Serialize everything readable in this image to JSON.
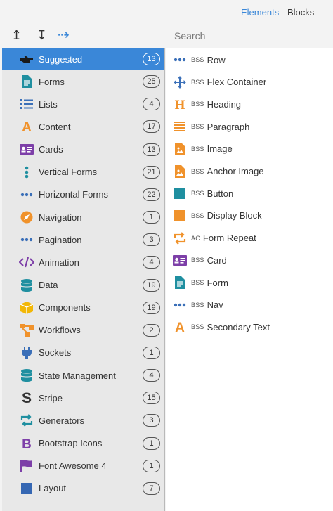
{
  "tabs": {
    "elements": "Elements",
    "blocks": "Blocks"
  },
  "toolbar": {
    "up": "↥",
    "down": "↧",
    "right": "⇢"
  },
  "search": {
    "placeholder": "Search"
  },
  "categories": [
    {
      "label": "Suggested",
      "count": "13",
      "icon": "pointing-hand-icon",
      "active": true
    },
    {
      "label": "Forms",
      "count": "25",
      "icon": "form-document-icon"
    },
    {
      "label": "Lists",
      "count": "4",
      "icon": "list-icon"
    },
    {
      "label": "Content",
      "count": "17",
      "icon": "letter-a-icon"
    },
    {
      "label": "Cards",
      "count": "13",
      "icon": "id-card-icon"
    },
    {
      "label": "Vertical Forms",
      "count": "21",
      "icon": "vertical-dots-icon"
    },
    {
      "label": "Horizontal Forms",
      "count": "22",
      "icon": "horizontal-dots-icon"
    },
    {
      "label": "Navigation",
      "count": "1",
      "icon": "compass-icon"
    },
    {
      "label": "Pagination",
      "count": "3",
      "icon": "horizontal-dots-icon"
    },
    {
      "label": "Animation",
      "count": "4",
      "icon": "code-icon"
    },
    {
      "label": "Data",
      "count": "19",
      "icon": "database-icon"
    },
    {
      "label": "Components",
      "count": "19",
      "icon": "cube-icon"
    },
    {
      "label": "Workflows",
      "count": "2",
      "icon": "workflow-icon"
    },
    {
      "label": "Sockets",
      "count": "1",
      "icon": "plug-icon"
    },
    {
      "label": "State Management",
      "count": "4",
      "icon": "database-icon"
    },
    {
      "label": "Stripe",
      "count": "15",
      "icon": "stripe-s-icon"
    },
    {
      "label": "Generators",
      "count": "3",
      "icon": "repeat-arrows-icon"
    },
    {
      "label": "Bootstrap Icons",
      "count": "1",
      "icon": "bootstrap-b-icon"
    },
    {
      "label": "Font Awesome 4",
      "count": "1",
      "icon": "flag-icon"
    },
    {
      "label": "Layout",
      "count": "7",
      "icon": "square-icon"
    }
  ],
  "elements": [
    {
      "prefix": "BSS",
      "label": "Row",
      "icon": "horizontal-dots-icon"
    },
    {
      "prefix": "BSS",
      "label": "Flex Container",
      "icon": "move-arrows-icon"
    },
    {
      "prefix": "BSS",
      "label": "Heading",
      "icon": "heading-h-icon"
    },
    {
      "prefix": "BSS",
      "label": "Paragraph",
      "icon": "paragraph-lines-icon"
    },
    {
      "prefix": "BSS",
      "label": "Image",
      "icon": "image-file-icon"
    },
    {
      "prefix": "BSS",
      "label": "Anchor Image",
      "icon": "image-file-icon"
    },
    {
      "prefix": "BSS",
      "label": "Button",
      "icon": "teal-square-icon"
    },
    {
      "prefix": "BSS",
      "label": "Display Block",
      "icon": "orange-square-icon"
    },
    {
      "prefix": "AC",
      "label": "Form Repeat",
      "icon": "repeat-arrows-icon"
    },
    {
      "prefix": "BSS",
      "label": "Card",
      "icon": "id-card-icon"
    },
    {
      "prefix": "BSS",
      "label": "Form",
      "icon": "form-document-icon"
    },
    {
      "prefix": "BSS",
      "label": "Nav",
      "icon": "horizontal-dots-icon"
    },
    {
      "prefix": "BSS",
      "label": "Secondary Text",
      "icon": "letter-a-icon"
    }
  ],
  "colors": {
    "accent": "#3a87d8",
    "teal": "#1f8fa0",
    "orange": "#f0922b",
    "purple": "#7d3fa8"
  }
}
